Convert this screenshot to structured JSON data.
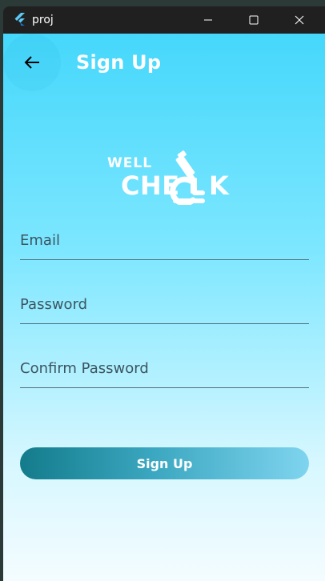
{
  "window": {
    "title": "proj",
    "app_icon": "flutter-icon",
    "controls": [
      "minimize-icon",
      "maximize-icon",
      "close-icon"
    ]
  },
  "header": {
    "back_icon": "arrow-left-icon",
    "title": "Sign Up"
  },
  "logo": {
    "small_text": "WELL",
    "big_text": "CHE",
    "big_text_end": "K",
    "icon": "microscope-icon"
  },
  "form": {
    "email_placeholder": "Email",
    "email_value": "",
    "password_placeholder": "Password",
    "password_value": "",
    "confirm_placeholder": "Confirm Password",
    "confirm_value": "",
    "submit_label": "Sign Up"
  },
  "colors": {
    "gradient_top": "#45d7fb",
    "gradient_bottom": "#f4fcff",
    "button_start": "#137b8b",
    "button_end": "#7fd4ef",
    "titlebar": "#202020"
  }
}
